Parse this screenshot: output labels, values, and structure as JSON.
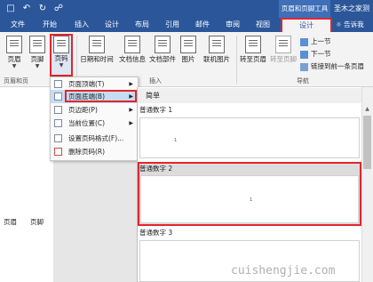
{
  "quick_access": [
    "save-icon",
    "undo-icon",
    "redo-icon",
    "print-preview-icon"
  ],
  "context_group": "页眉和页脚工具",
  "document_name": "圣木之家测",
  "tabs": [
    "文件",
    "开始",
    "插入",
    "设计",
    "布局",
    "引用",
    "邮件",
    "审阅",
    "视图"
  ],
  "active_tab": "设计",
  "tell_me": "告诉我",
  "ribbon": {
    "header_label": "页眉",
    "footer_label": "页脚",
    "page_number_label": "页码",
    "datetime_label": "日期和时间",
    "docinfo_label": "文档信息",
    "docparts_label": "文档部件",
    "picture_label": "图片",
    "online_picture_label": "联机图片",
    "goto_header_label": "转至页眉",
    "goto_footer_label": "转至页脚",
    "prev_label": "上一节",
    "next_label": "下一节",
    "link_prev_label": "链接到前一条页眉",
    "group_header_footer": "页眉和页",
    "group_insert": "插入",
    "group_nav": "导航"
  },
  "side_labels": [
    "页眉",
    "页脚"
  ],
  "menu": {
    "items": [
      {
        "label": "页面顶端(T)",
        "has_arrow": true
      },
      {
        "label": "页面底端(B)",
        "has_arrow": true
      },
      {
        "label": "页边距(P)",
        "has_arrow": true
      },
      {
        "label": "当前位置(C)",
        "has_arrow": true
      },
      {
        "label": "设置页码格式(F)...",
        "has_arrow": false
      },
      {
        "label": "删除页码(R)",
        "has_arrow": false
      }
    ]
  },
  "gallery": {
    "header": "简单",
    "sections": [
      {
        "title": "普通数字 1",
        "number": "1"
      },
      {
        "title": "普通数字 2",
        "number": "1"
      },
      {
        "title": "普通数字 3",
        "number": ""
      }
    ]
  },
  "watermark": "cuishengjie.com"
}
